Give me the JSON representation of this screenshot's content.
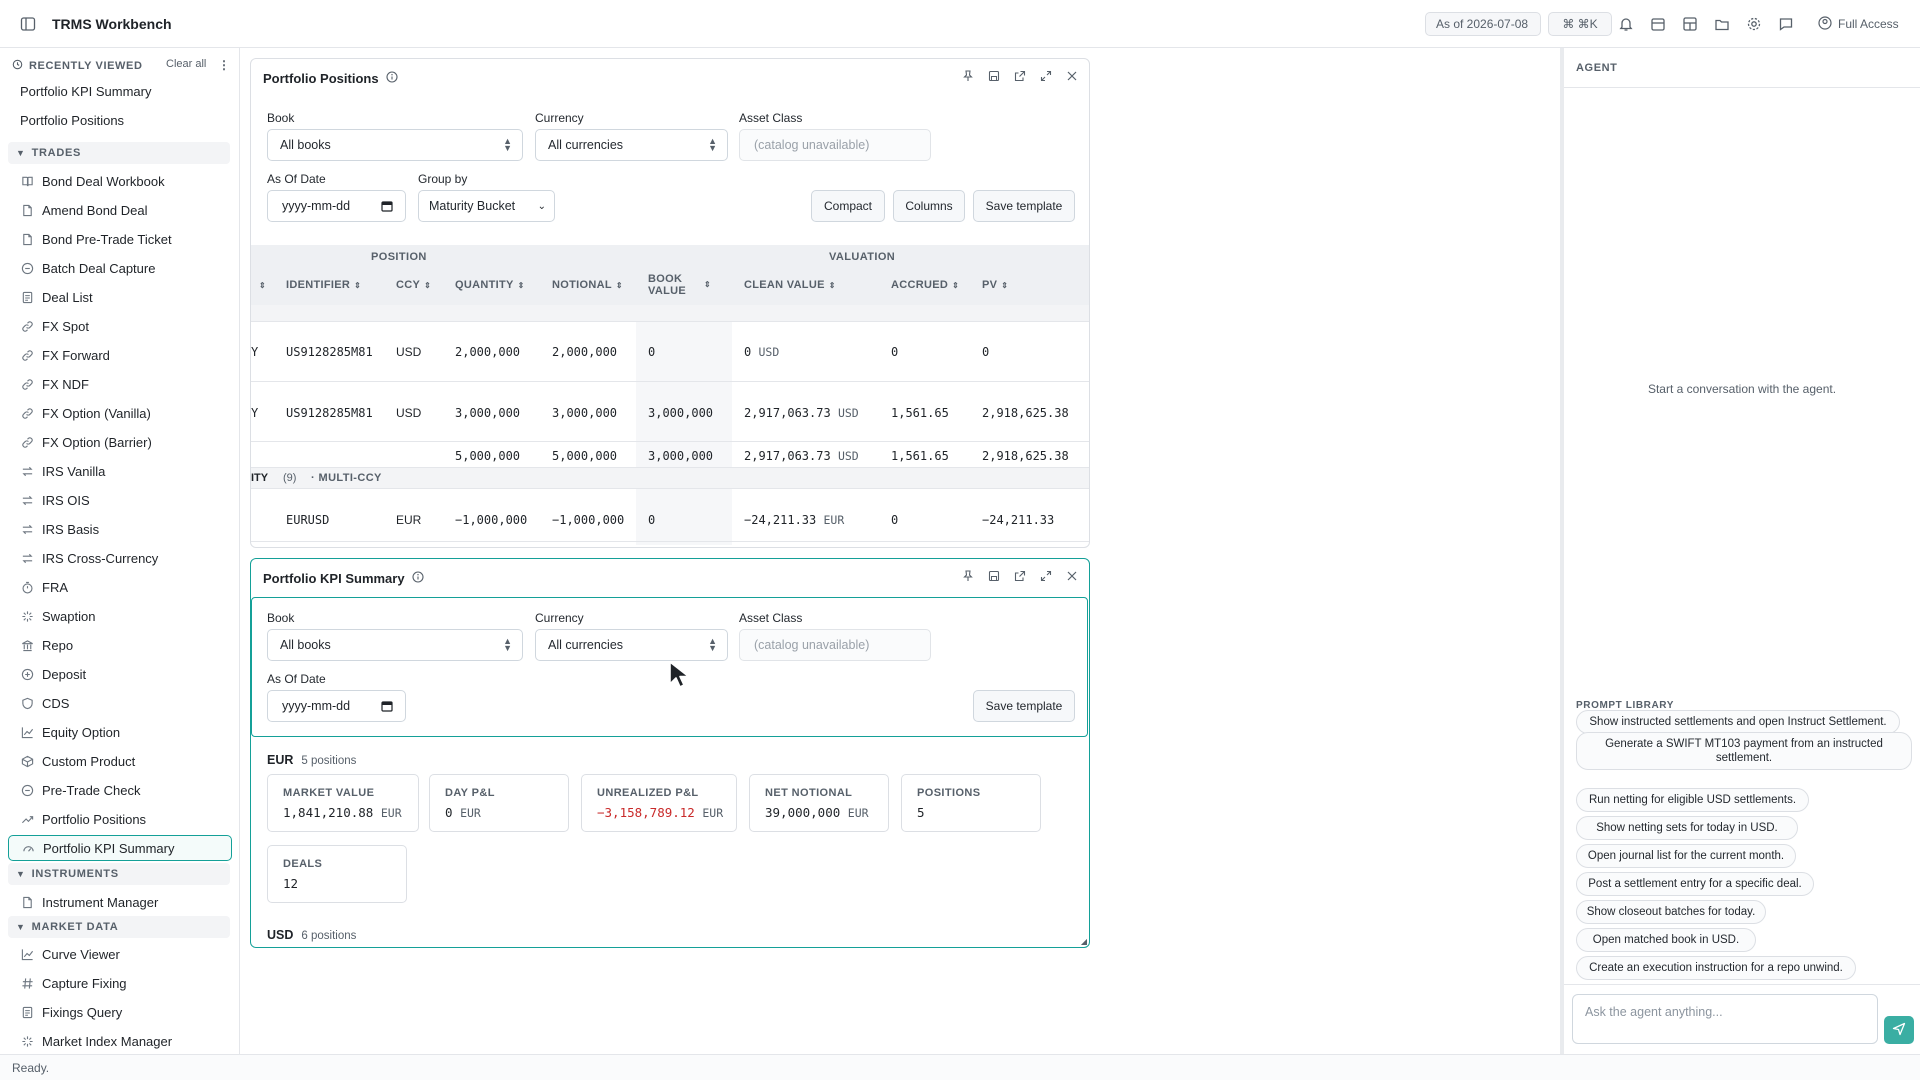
{
  "app": {
    "title": "TRMS Workbench",
    "as_of": "As of 2026-07-08",
    "shortcut": "⌘ ⌘K",
    "access": "Full Access"
  },
  "sidebar": {
    "recently_viewed_label": "RECENTLY VIEWED",
    "clear_all": "Clear all",
    "recent": [
      "Portfolio KPI Summary",
      "Portfolio Positions"
    ],
    "sections": {
      "trades": "TRADES",
      "instruments": "INSTRUMENTS",
      "market_data": "MARKET DATA"
    },
    "trades": [
      "Bond Deal Workbook",
      "Amend Bond Deal",
      "Bond Pre-Trade Ticket",
      "Batch Deal Capture",
      "Deal List",
      "FX Spot",
      "FX Forward",
      "FX NDF",
      "FX Option (Vanilla)",
      "FX Option (Barrier)",
      "IRS Vanilla",
      "IRS OIS",
      "IRS Basis",
      "IRS Cross-Currency",
      "FRA",
      "Swaption",
      "Repo",
      "Deposit",
      "CDS",
      "Equity Option",
      "Custom Product",
      "Pre-Trade Check",
      "Portfolio Positions",
      "Portfolio KPI Summary"
    ],
    "instruments": [
      "Instrument Manager"
    ],
    "market_data": [
      "Curve Viewer",
      "Capture Fixing",
      "Fixings Query",
      "Market Index Manager"
    ]
  },
  "positions_panel": {
    "title": "Portfolio Positions",
    "book_label": "Book",
    "book_value": "All books",
    "currency_label": "Currency",
    "currency_value": "All currencies",
    "asset_label": "Asset Class",
    "asset_placeholder": "(catalog unavailable)",
    "asof_label": "As Of Date",
    "asof_placeholder": "yyyy-mm-dd",
    "groupby_label": "Group by",
    "groupby_value": "Maturity Bucket",
    "compact": "Compact",
    "columns": "Columns",
    "save_template": "Save template",
    "group_position": "POSITION",
    "group_valuation": "VALUATION",
    "headers": [
      "IDENTIFIER",
      "CCY",
      "QUANTITY",
      "NOTIONAL",
      "BOOK VALUE",
      "CLEAN VALUE",
      "ACCRUED",
      "PV"
    ],
    "rows": [
      {
        "cut": "Y",
        "identifier": "US9128285M81",
        "ccy": "USD",
        "quantity": "2,000,000",
        "notional": "2,000,000",
        "book_value": "0",
        "clean_value": "0",
        "clean_ccy": "USD",
        "accrued": "0",
        "pv": "0"
      },
      {
        "cut": "Y",
        "identifier": "US9128285M81",
        "ccy": "USD",
        "quantity": "3,000,000",
        "notional": "3,000,000",
        "book_value": "3,000,000",
        "clean_value": "2,917,063.73",
        "clean_ccy": "USD",
        "accrued": "1,561.65",
        "pv": "2,918,625.38"
      }
    ],
    "subtotal": {
      "quantity": "5,000,000",
      "notional": "5,000,000",
      "book_value": "3,000,000",
      "clean_value": "2,917,063.73",
      "clean_ccy": "USD",
      "accrued": "1,561.65",
      "pv": "2,918,625.38"
    },
    "group_row": {
      "name": "ITY",
      "count": "(9)",
      "tag": "· MULTI-CCY"
    },
    "row3": {
      "identifier": "EURUSD",
      "ccy": "EUR",
      "quantity": "−1,000,000",
      "notional": "−1,000,000",
      "book_value": "0",
      "clean_value": "−24,211.33",
      "clean_ccy": "EUR",
      "accrued": "0",
      "pv": "−24,211.33"
    }
  },
  "kpi_panel": {
    "title": "Portfolio KPI Summary",
    "book_label": "Book",
    "book_value": "All books",
    "currency_label": "Currency",
    "currency_value": "All currencies",
    "asset_label": "Asset Class",
    "asset_placeholder": "(catalog unavailable)",
    "asof_label": "As Of Date",
    "asof_placeholder": "yyyy-mm-dd",
    "save_template": "Save template",
    "eur": {
      "ccy": "EUR",
      "count": "5 positions"
    },
    "usd": {
      "ccy": "USD",
      "count": "6 positions"
    },
    "cards": {
      "market_value": {
        "label": "MARKET VALUE",
        "value": "1,841,210.88",
        "unit": "EUR"
      },
      "day_pnl": {
        "label": "DAY P&L",
        "value": "0",
        "unit": "EUR"
      },
      "unrealized_pnl": {
        "label": "UNREALIZED P&L",
        "value": "−3,158,789.12",
        "unit": "EUR"
      },
      "net_notional": {
        "label": "NET NOTIONAL",
        "value": "39,000,000",
        "unit": "EUR"
      },
      "positions": {
        "label": "POSITIONS",
        "value": "5"
      },
      "deals": {
        "label": "DEALS",
        "value": "12"
      }
    }
  },
  "agent": {
    "header": "AGENT",
    "empty": "Start a conversation with the agent.",
    "prompt_library_label": "PROMPT LIBRARY",
    "prompts": [
      "Show instructed settlements and open Instruct Settlement.",
      "Generate a SWIFT MT103 payment from an instructed settlement.",
      "Run netting for eligible USD settlements.",
      "Show netting sets for today in USD.",
      "Open journal list for the current month.",
      "Post a settlement entry for a specific deal.",
      "Show closeout batches for today.",
      "Open matched book in USD.",
      "Create an execution instruction for a repo unwind."
    ],
    "input_placeholder": "Ask the agent anything..."
  },
  "status": {
    "text": "Ready."
  },
  "colors": {
    "accent": "#14a098",
    "negative": "#c92a2a"
  }
}
